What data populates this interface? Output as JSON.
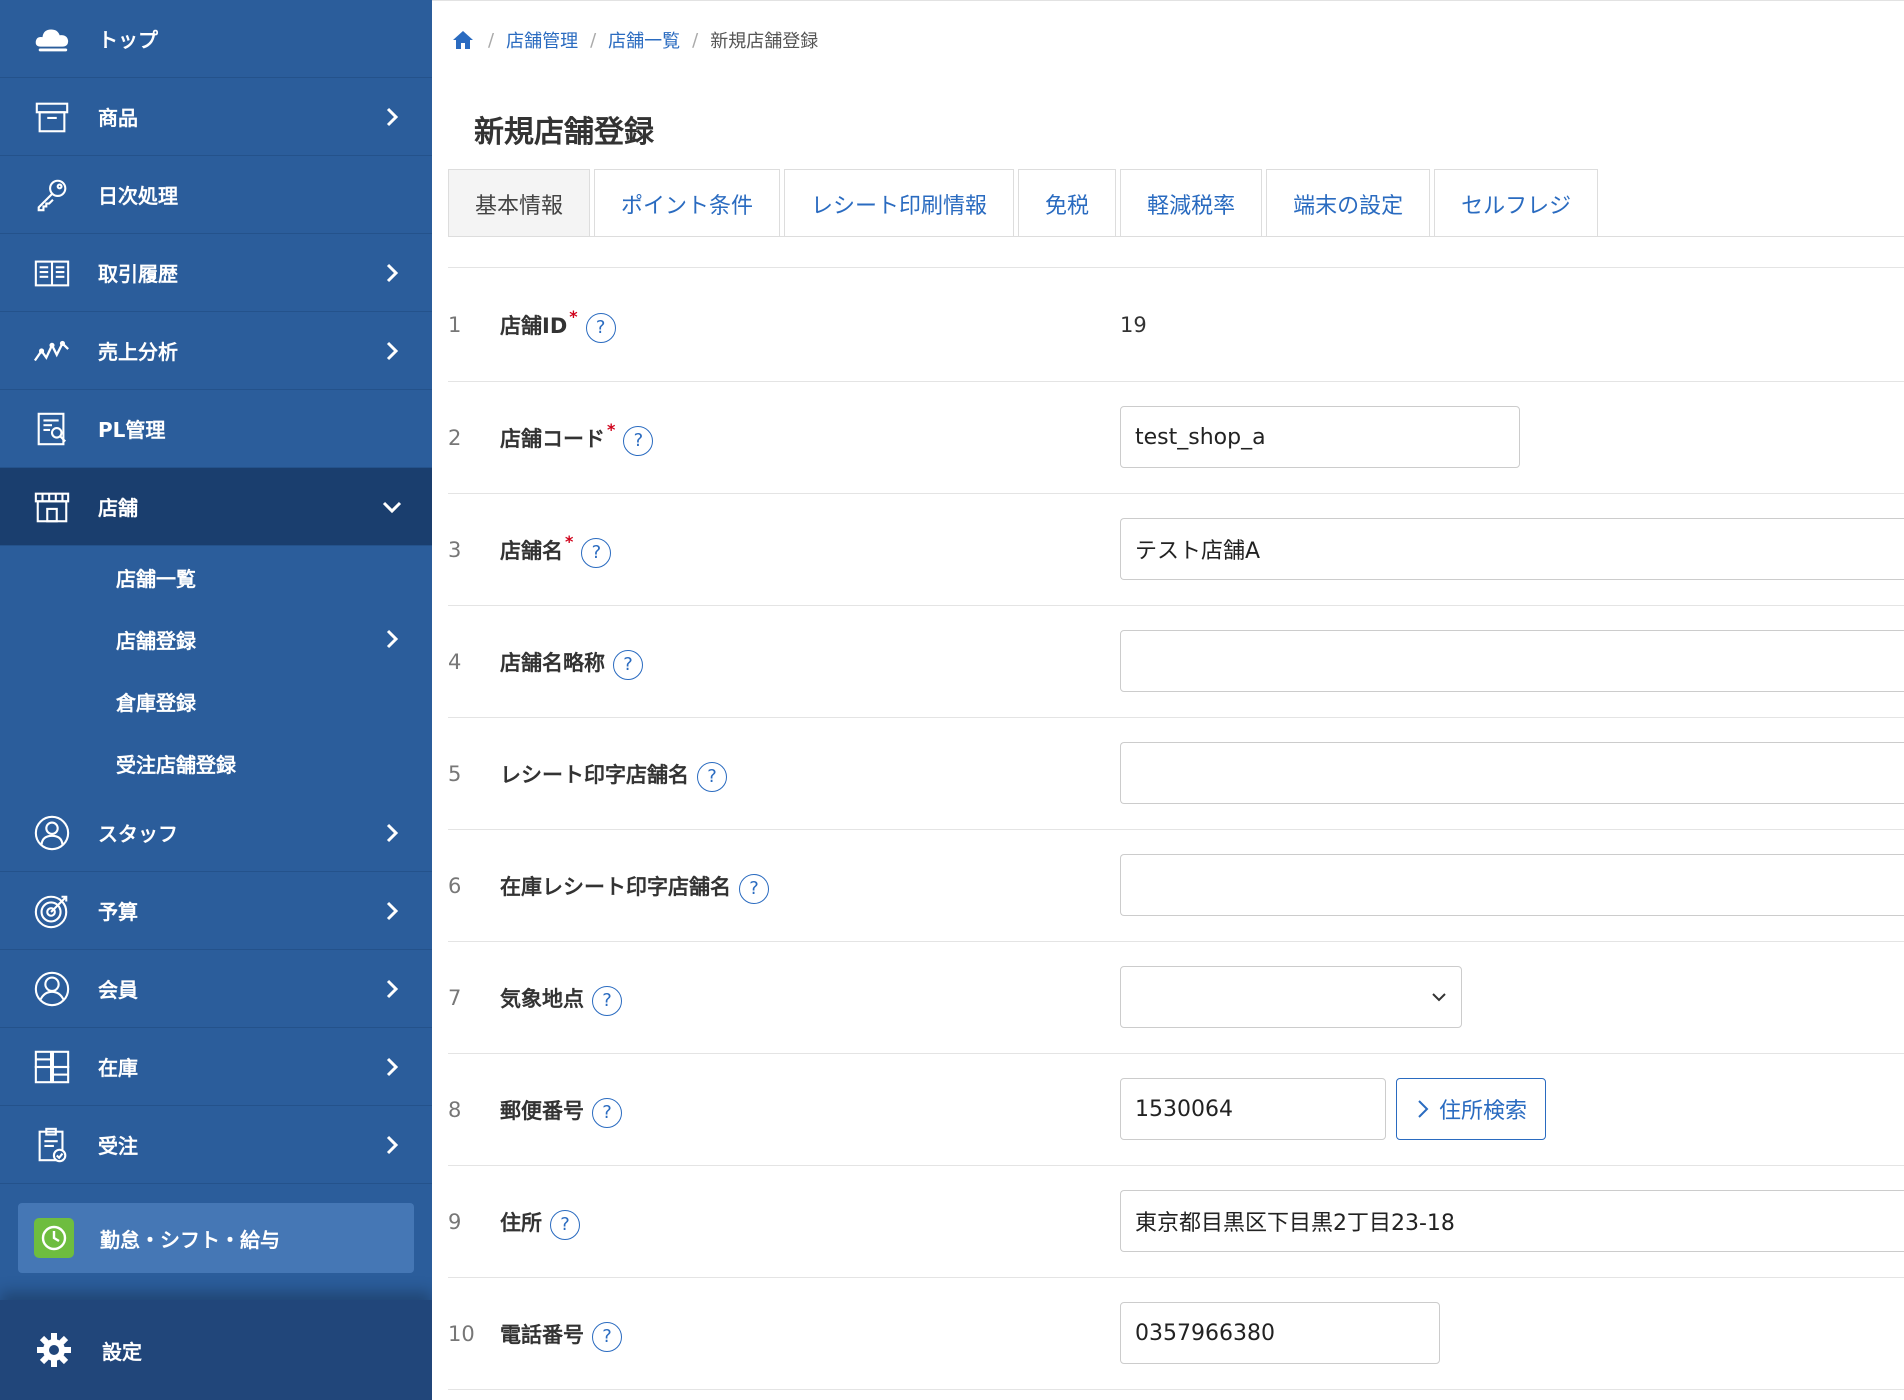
{
  "sidebar": {
    "items": [
      {
        "label": "トップ",
        "icon": "cloud-icon",
        "has_arrow": false
      },
      {
        "label": "商品",
        "icon": "box-icon",
        "has_arrow": true
      },
      {
        "label": "日次処理",
        "icon": "key-icon",
        "has_arrow": false
      },
      {
        "label": "取引履歴",
        "icon": "book-icon",
        "has_arrow": true
      },
      {
        "label": "売上分析",
        "icon": "trend-icon",
        "has_arrow": true
      },
      {
        "label": "PL管理",
        "icon": "report-icon",
        "has_arrow": false
      },
      {
        "label": "店舗",
        "icon": "store-icon",
        "has_arrow": true,
        "active": true
      }
    ],
    "submenu": [
      {
        "label": "店舗一覧",
        "has_arrow": false
      },
      {
        "label": "店舗登録",
        "has_arrow": true
      },
      {
        "label": "倉庫登録",
        "has_arrow": false
      },
      {
        "label": "受注店舗登録",
        "has_arrow": false
      }
    ],
    "items_after": [
      {
        "label": "スタッフ",
        "icon": "staff-icon",
        "has_arrow": true
      },
      {
        "label": "予算",
        "icon": "target-icon",
        "has_arrow": true
      },
      {
        "label": "会員",
        "icon": "member-icon",
        "has_arrow": true
      },
      {
        "label": "在庫",
        "icon": "inventory-icon",
        "has_arrow": true
      },
      {
        "label": "受注",
        "icon": "clipboard-icon",
        "has_arrow": true
      }
    ],
    "kintai_label": "勤怠・シフト・給与",
    "settings_label": "設定"
  },
  "breadcrumb": {
    "items": [
      "店舗管理",
      "店舗一覧"
    ],
    "current": "新規店舗登録"
  },
  "page_title": "新規店舗登録",
  "tabs": [
    "基本情報",
    "ポイント条件",
    "レシート印刷情報",
    "免税",
    "軽減税率",
    "端末の設定",
    "セルフレジ"
  ],
  "form": {
    "help_glyph": "?",
    "required_mark": "*",
    "rows": [
      {
        "num": "1",
        "label": "店舗ID",
        "required": true,
        "value": "19"
      },
      {
        "num": "2",
        "label": "店舗コード",
        "required": true,
        "value": "test_shop_a"
      },
      {
        "num": "3",
        "label": "店舗名",
        "required": true,
        "value": "テスト店舗A"
      },
      {
        "num": "4",
        "label": "店舗名略称",
        "required": false,
        "value": ""
      },
      {
        "num": "5",
        "label": "レシート印字店舗名",
        "required": false,
        "value": ""
      },
      {
        "num": "6",
        "label": "在庫レシート印字店舗名",
        "required": false,
        "value": ""
      },
      {
        "num": "7",
        "label": "気象地点",
        "required": false,
        "value": ""
      },
      {
        "num": "8",
        "label": "郵便番号",
        "required": false,
        "value": "1530064"
      },
      {
        "num": "9",
        "label": "住所",
        "required": false,
        "value": "東京都目黒区下目黒2丁目23-18"
      },
      {
        "num": "10",
        "label": "電話番号",
        "required": false,
        "value": "0357966380"
      }
    ],
    "address_search_label": "住所検索"
  },
  "colors": {
    "sidebar_bg": "#2b5d9b",
    "sidebar_active": "#1a3e6e",
    "link": "#2a6bc0",
    "required": "#d0021b",
    "kintai_icon": "#6ebd3f"
  }
}
